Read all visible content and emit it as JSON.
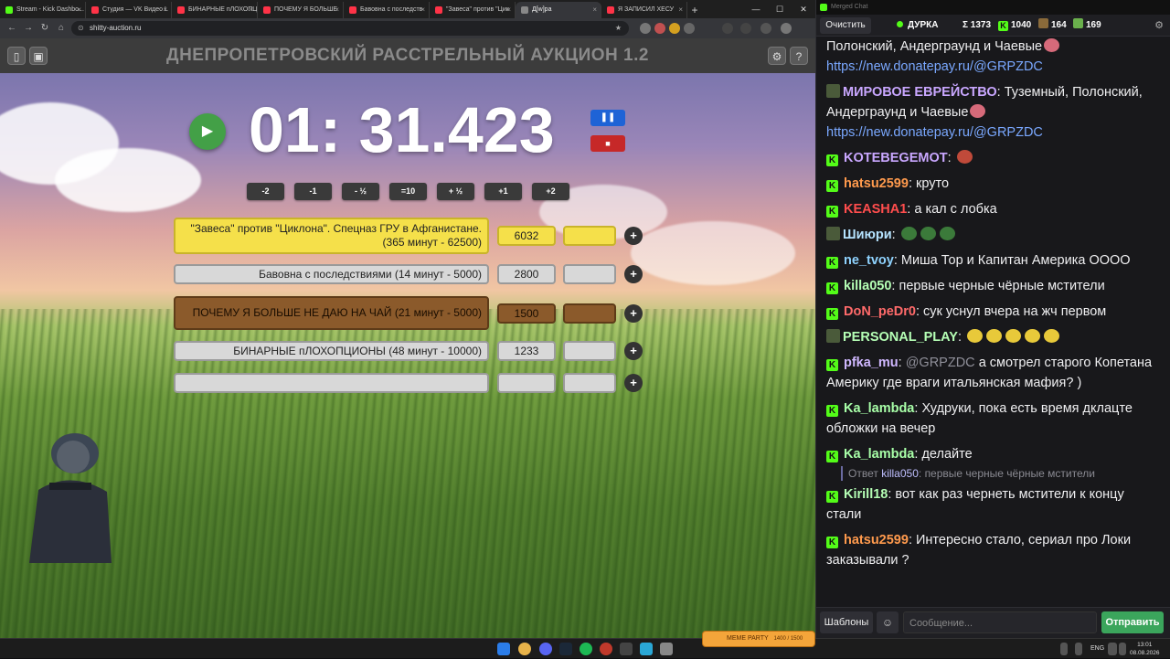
{
  "browser": {
    "tabs": [
      {
        "label": "Stream - Kick Dashbo...",
        "color": "#53fc18",
        "active": false
      },
      {
        "label": "Студия — VK Видео L",
        "color": "#ff3347",
        "active": false
      },
      {
        "label": "БИНАРНЫЕ пЛОХОПЦ",
        "color": "#ff3347",
        "active": false
      },
      {
        "label": "ПОЧЕМУ Я БОЛЬШЕ",
        "color": "#ff3347",
        "active": false
      },
      {
        "label": "Бавовна с последств",
        "color": "#ff3347",
        "active": false
      },
      {
        "label": "\"Завеса\" против \"Цик",
        "color": "#ff3347",
        "active": false
      },
      {
        "label": "Д[w]ра",
        "color": "#888888",
        "active": true
      },
      {
        "label": "Я ЗАПИСИЛ ХЕСУ",
        "color": "#ff3347",
        "active": false
      }
    ],
    "url": "shitty-auction.ru"
  },
  "auction": {
    "title": "ДНЕПРОПЕТРОВСКИЙ РАССТРЕЛЬНЫЙ АУКЦИОН 1.2",
    "timer": "01: 31.423",
    "adjust_buttons": [
      "-2",
      "-1",
      "- ½",
      "=10",
      "+ ½",
      "+1",
      "+2"
    ],
    "lots": [
      {
        "name": "\"Завеса\" против \"Циклона\". Спецназ ГРУ в Афганистане. (365 минут - 62500)",
        "amount": "6032",
        "color": "#f5e04a",
        "border": "#c9b42a"
      },
      {
        "name": "Бавовна с последствиями (14 минут - 5000)",
        "amount": "2800",
        "color": "#d8d8d8",
        "border": "#9a9a9a"
      },
      {
        "name": "ПОЧЕМУ Я БОЛЬШЕ НЕ ДАЮ НА ЧАЙ (21 минут - 5000)",
        "amount": "1500",
        "color": "#8b5a2b",
        "border": "#5e3b18"
      },
      {
        "name": "БИНАРНЫЕ пЛОХОПЦИОНЫ (48 минут - 10000)",
        "amount": "1233",
        "color": "#d8d8d8",
        "border": "#9a9a9a"
      },
      {
        "name": "",
        "amount": "",
        "color": "#d8d8d8",
        "border": "#9a9a9a"
      }
    ]
  },
  "chat": {
    "window_title": "Merged Chat",
    "clear_label": "Очистить",
    "streamer": "ДУРКА",
    "total": "Σ 1373",
    "kick_count": "1040",
    "other_count": "164",
    "vk_count": "169",
    "messages": [
      {
        "user": "",
        "color": "#ffffff",
        "text": "Полонский, Андерграунд и Чаевые",
        "link": "https://new.donatepay.ru/@GRPZDC",
        "badge": "none"
      },
      {
        "user": "МИРОВОЕ ЕВРЕЙСТВО",
        "color": "#c9a7ff",
        "text": "Туземный, Полонский, Андерграунд и Чаевые",
        "link": "https://new.donatepay.ru/@GRPZDC",
        "badge": "vk"
      },
      {
        "user": "KOTEBEGEMOT",
        "color": "#c9a7ff",
        "text": "",
        "link": "",
        "badge": "kick"
      },
      {
        "user": "hatsu2599",
        "color": "#ff9a4d",
        "text": "круто",
        "link": "",
        "badge": "kick"
      },
      {
        "user": "KEASHA1",
        "color": "#ff4d4d",
        "text": "а кал с лобка",
        "link": "",
        "badge": "kick"
      },
      {
        "user": "Шиюри",
        "color": "#b5e3ff",
        "text": "",
        "link": "",
        "badge": "vk"
      },
      {
        "user": "ne_tvoy",
        "color": "#8fd3ff",
        "text": "Миша Тор и Капитан Америка ОООО",
        "link": "",
        "badge": "kick"
      },
      {
        "user": "killa050",
        "color": "#b5ffb5",
        "text": "первые черные чёрные мстители",
        "link": "",
        "badge": "kick"
      },
      {
        "user": "DoN_peDr0",
        "color": "#ff6a6a",
        "text": "сук уснул вчера на жч первом",
        "link": "",
        "badge": "kick"
      },
      {
        "user": "PERSONAL_PLAY",
        "color": "#b5ffb5",
        "text": "",
        "link": "",
        "badge": "vk"
      },
      {
        "user": "pfka_mu",
        "color": "#d0b8ff",
        "mention": "@GRPZDC",
        "text": "а смотрел старого Копетана  Америку где враги итальянская мафия? )",
        "link": "",
        "badge": "kick"
      },
      {
        "user": "Ka_lambda",
        "color": "#a8ffa8",
        "text": "Худруки, пока есть время дклацте обложки на вечер",
        "link": "",
        "badge": "kick"
      },
      {
        "user": "Ka_lambda",
        "color": "#a8ffa8",
        "text": "делайте",
        "link": "",
        "badge": "kick"
      },
      {
        "user": "Kirill18",
        "color": "#b5ffb5",
        "text": "вот как раз чернеть мстители к концу стали",
        "link": "",
        "badge": "kick"
      },
      {
        "user": "hatsu2599",
        "color": "#ff9a4d",
        "text": "Интересно стало, сериал про Локи заказывали ?",
        "link": "",
        "badge": "kick"
      }
    ],
    "reply": {
      "prefix": "Ответ",
      "user": "killa050",
      "text": "первые черные чёрные мстители"
    },
    "templates_label": "Шаблоны",
    "input_placeholder": "Сообщение...",
    "send_label": "Отправить"
  },
  "taskbar": {
    "lang": "ENG",
    "time": "13:01",
    "date": "08.08.2026",
    "meme_label": "MEME PARTY",
    "meme_progress": "1400 / 1500"
  }
}
